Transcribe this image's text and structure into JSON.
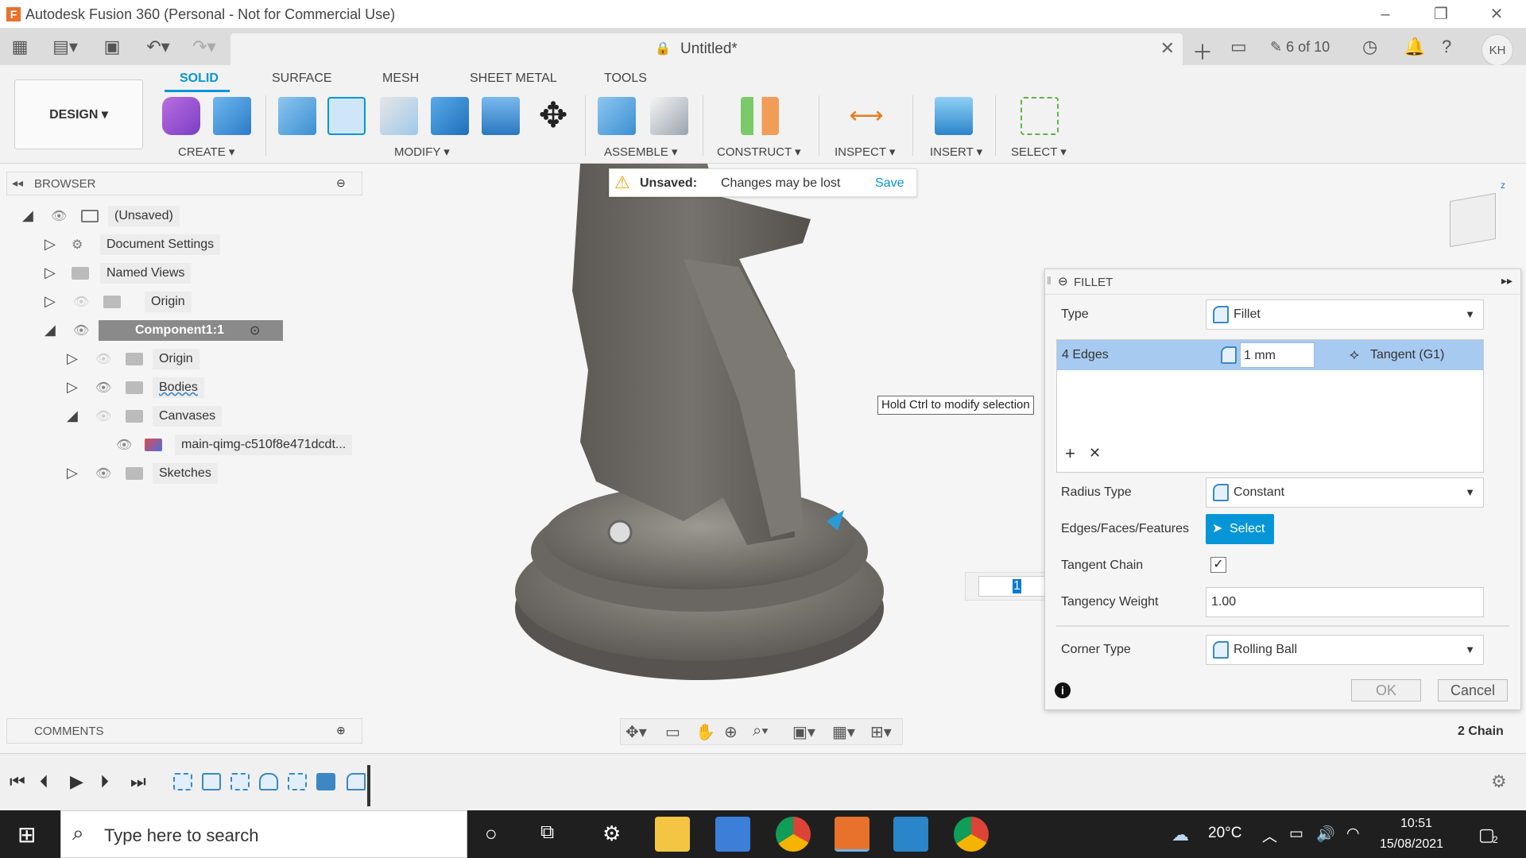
{
  "window": {
    "title": "Autodesk Fusion 360 (Personal - Not for Commercial Use)",
    "app_icon_letter": "F"
  },
  "document_tab": {
    "name": "Untitled*"
  },
  "header_right": {
    "job_status": "6 of 10",
    "avatar_initials": "KH"
  },
  "toolbar": {
    "workspace": "DESIGN ▾",
    "tabs": [
      "SOLID",
      "SURFACE",
      "MESH",
      "SHEET METAL",
      "TOOLS"
    ],
    "groups": [
      "CREATE ▾",
      "MODIFY ▾",
      "ASSEMBLE ▾",
      "CONSTRUCT ▾",
      "INSPECT ▾",
      "INSERT ▾",
      "SELECT ▾"
    ]
  },
  "browser": {
    "title": "BROWSER",
    "items": [
      {
        "label": "(Unsaved)"
      },
      {
        "label": "Document Settings"
      },
      {
        "label": "Named Views"
      },
      {
        "label": "Origin"
      },
      {
        "label": "Component1:1"
      },
      {
        "label": "Origin"
      },
      {
        "label": "Bodies"
      },
      {
        "label": "Canvases"
      },
      {
        "label": "main-qimg-c510f8e471dcdt..."
      },
      {
        "label": "Sketches"
      }
    ]
  },
  "unsaved_banner": {
    "label": "Unsaved:",
    "message": "Changes may be lost",
    "action": "Save"
  },
  "tooltip": "Hold Ctrl to modify selection",
  "fillet_panel": {
    "title": "FILLET",
    "type_label": "Type",
    "type_value": "Fillet",
    "edge_set": {
      "count": "4 Edges",
      "radius": "1 mm",
      "continuity": "Tangent (G1)"
    },
    "radius_type_label": "Radius Type",
    "radius_type_value": "Constant",
    "edges_label": "Edges/Faces/Features",
    "select_button": "Select",
    "tangent_chain_label": "Tangent Chain",
    "tangent_chain_checked": true,
    "tangency_weight_label": "Tangency Weight",
    "tangency_weight_value": "1.00",
    "corner_type_label": "Corner Type",
    "corner_type_value": "Rolling Ball",
    "ok": "OK",
    "cancel": "Cancel"
  },
  "inline_input_value": "1",
  "chain_status": "2 Chain",
  "comments": {
    "title": "COMMENTS"
  },
  "taskbar": {
    "search_placeholder": "Type here to search",
    "weather": "20°C",
    "time": "10:51",
    "date": "15/08/2021",
    "notification_count": "2"
  },
  "colors": {
    "accent": "#0696d7",
    "selection": "#a7caf0",
    "model": "#6f6b67",
    "taskbar": "#1f1f1f"
  }
}
